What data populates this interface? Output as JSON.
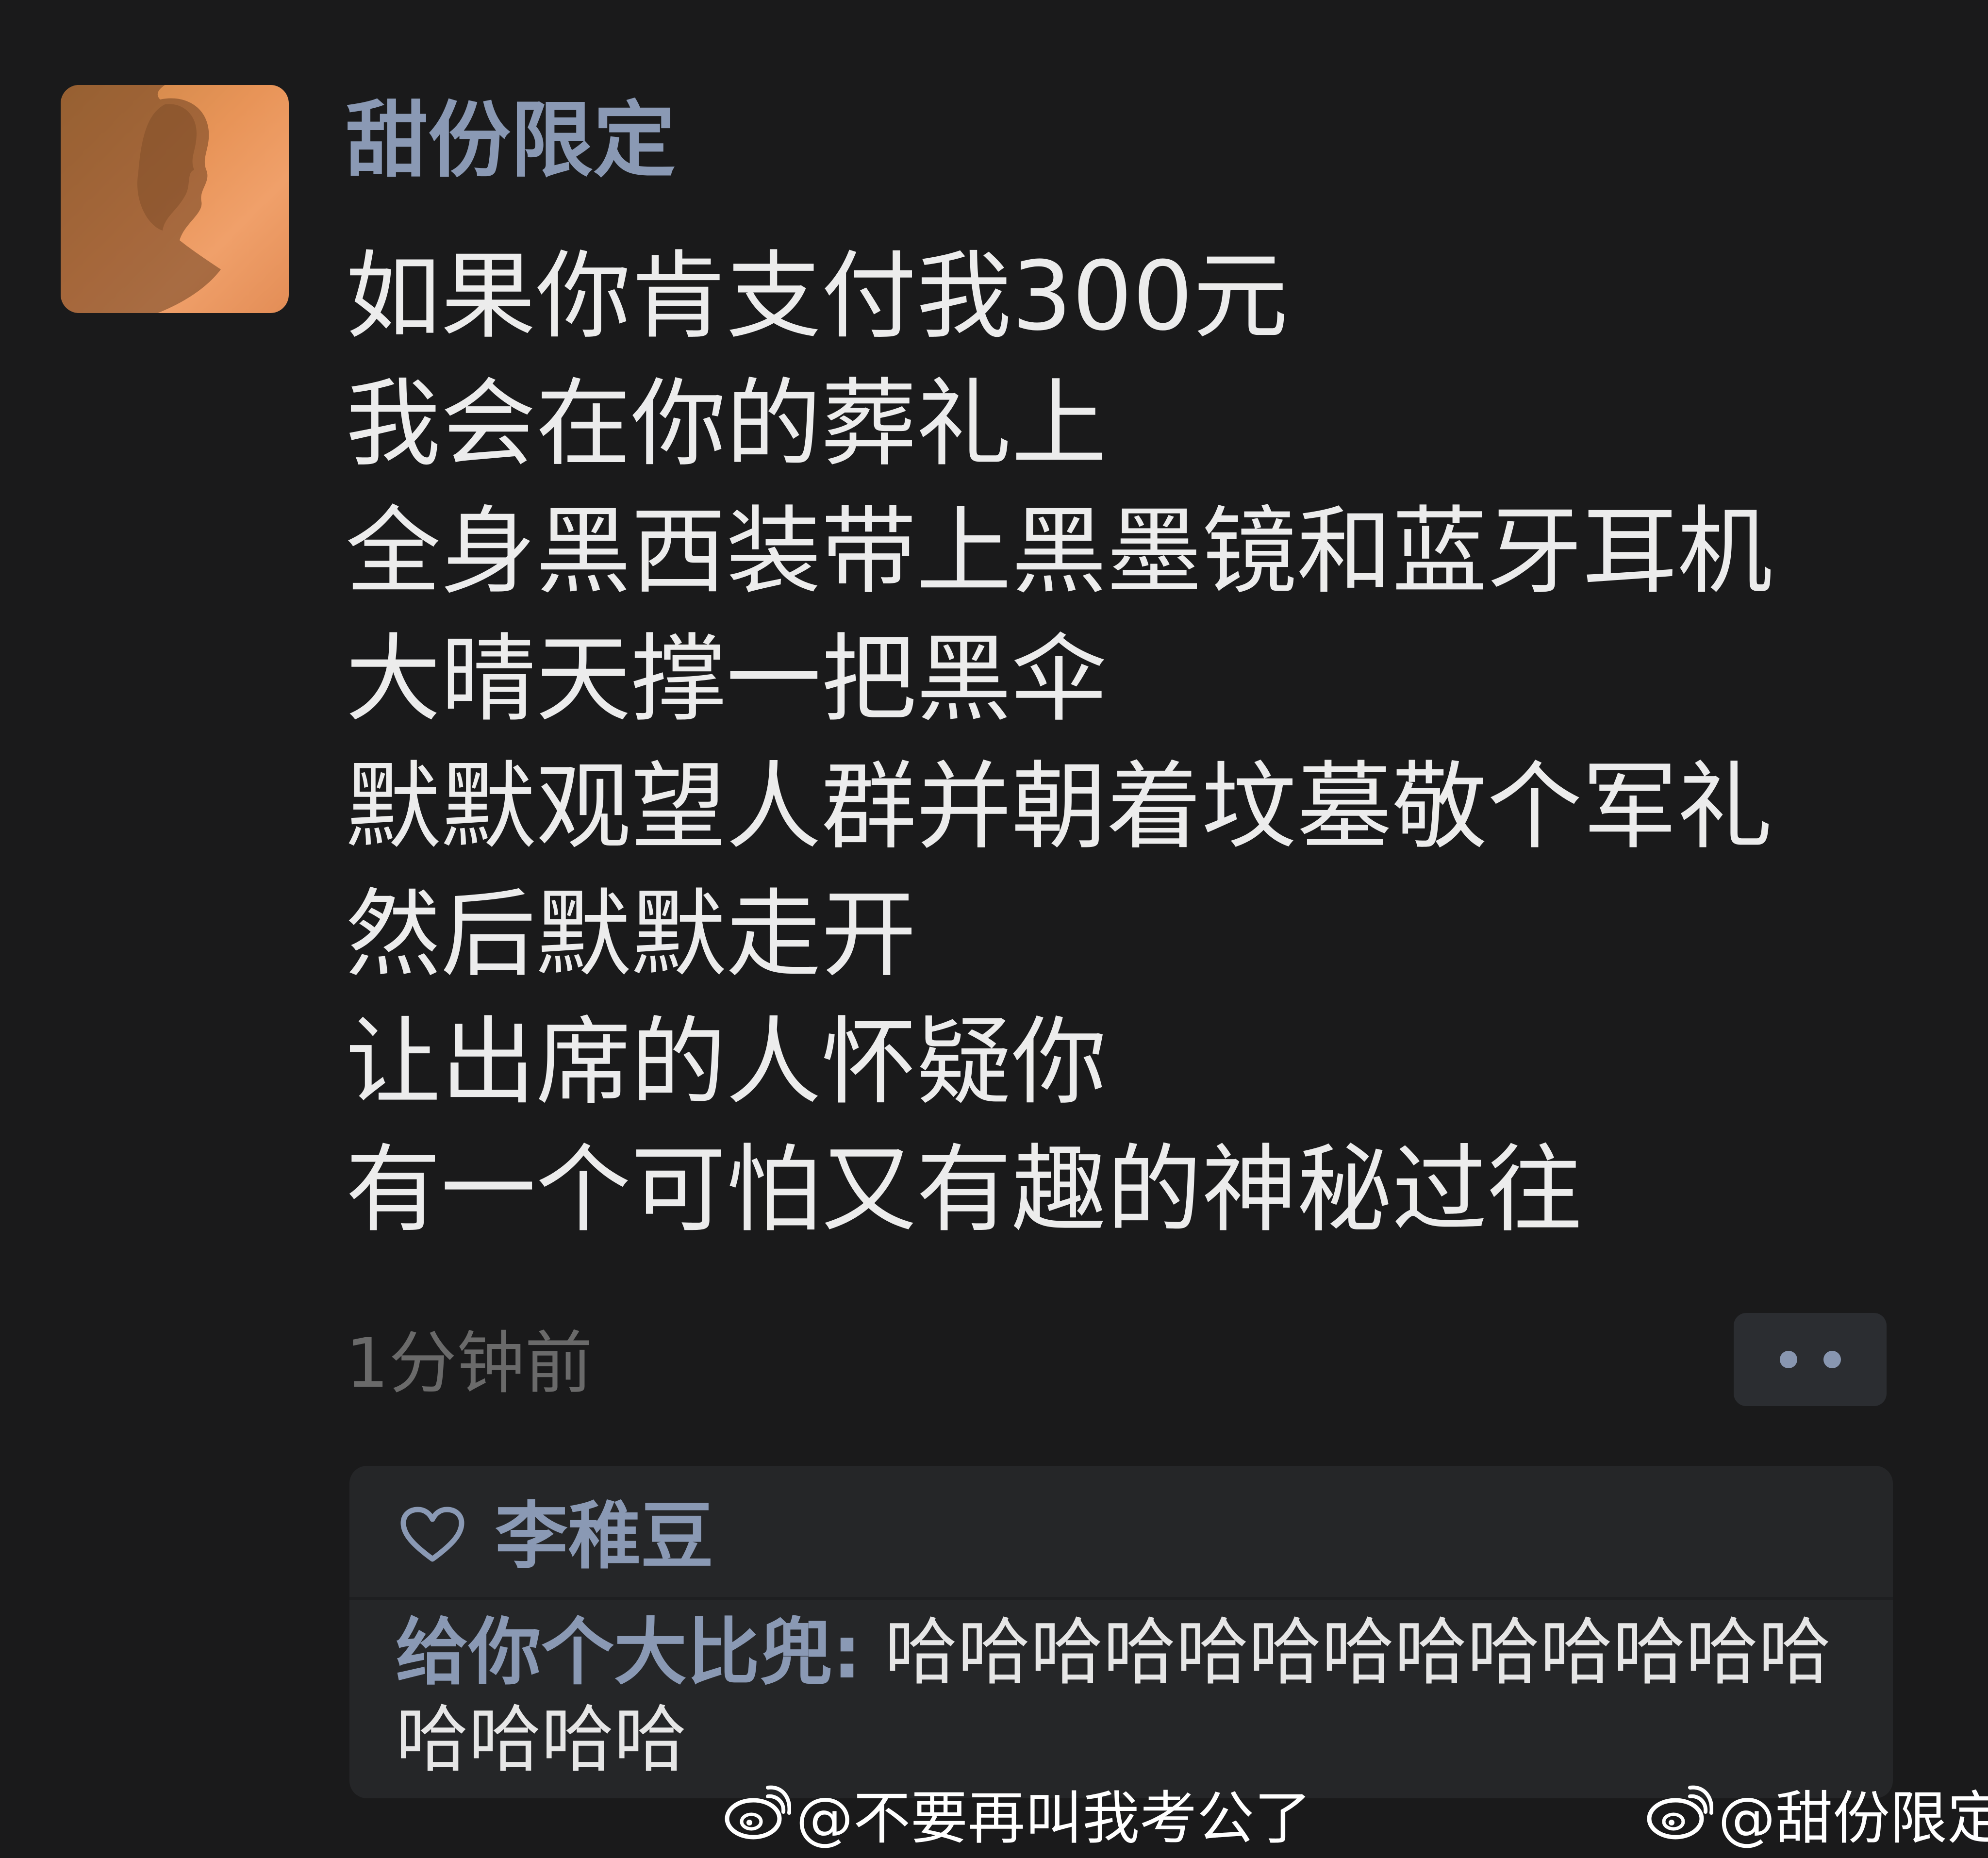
{
  "post": {
    "username": "甜份限定",
    "lines": [
      "如果你肯支付我300元",
      "我会在你的葬礼上",
      "全身黑西装带上黑墨镜和蓝牙耳机",
      "大晴天撑一把黑伞",
      "默默观望人群并朝着坟墓敬个军礼",
      "然后默默走开",
      "让出席的人怀疑你",
      "有一个可怕又有趣的神秘过往"
    ],
    "timestamp": "1分钟前"
  },
  "reply_box": {
    "liker": "李稚豆",
    "reply_author": "给你个大比兜",
    "reply_colon": ":",
    "reply_text": " 哈哈哈哈哈哈哈哈哈哈哈哈哈哈哈哈哈"
  },
  "watermarks": [
    "@不要再叫我考公了",
    "@甜份限定"
  ],
  "colors": {
    "background": "#1a1a1b",
    "name_accent": "#8a99b4",
    "text": "#ececec",
    "muted": "#6a6a6a",
    "panel": "#252628"
  },
  "icons": {
    "like": "heart-outline-icon",
    "more": "more-dots-icon",
    "watermark": "weibo-logo-icon"
  }
}
